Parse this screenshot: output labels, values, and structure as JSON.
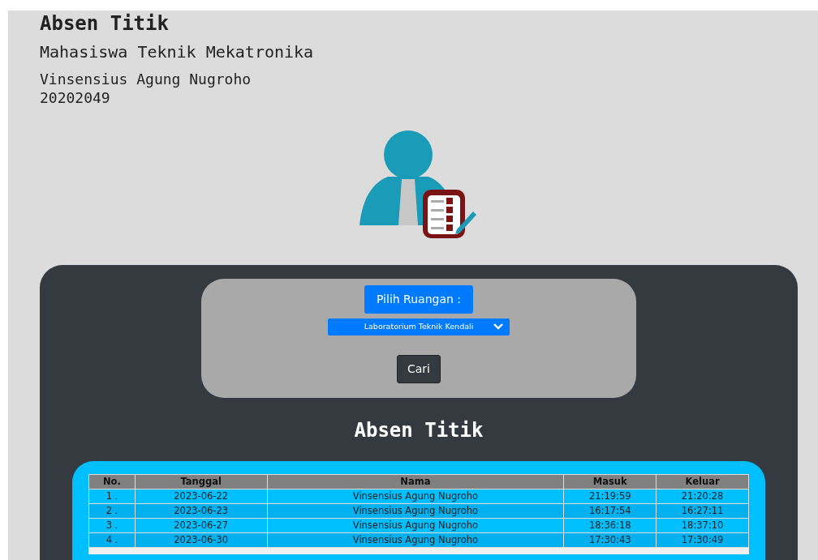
{
  "header": {
    "title": "Absen Titik",
    "subtitle": "Mahasiswa Teknik Mekatronika",
    "name": "Vinsensius Agung Nugroho",
    "id": "20202049"
  },
  "form": {
    "label": "Pilih Ruangan :",
    "select_value": "Laboratorium Teknik Kendali",
    "button": "Cari"
  },
  "section_title": "Absen Titik",
  "table": {
    "columns": [
      "No.",
      "Tanggal",
      "Nama",
      "Masuk",
      "Keluar"
    ],
    "rows": [
      [
        "1 .",
        "2023-06-22",
        "Vinsensius Agung Nugroho",
        "21:19:59",
        "21:20:28"
      ],
      [
        "2 .",
        "2023-06-23",
        "Vinsensius Agung Nugroho",
        "16:17:54",
        "16:27:11"
      ],
      [
        "3 .",
        "2023-06-27",
        "Vinsensius Agung Nugroho",
        "18:36:18",
        "18:37:10"
      ],
      [
        "4 .",
        "2023-06-30",
        "Vinsensius Agung Nugroho",
        "17:30:43",
        "17:30:49"
      ]
    ]
  }
}
